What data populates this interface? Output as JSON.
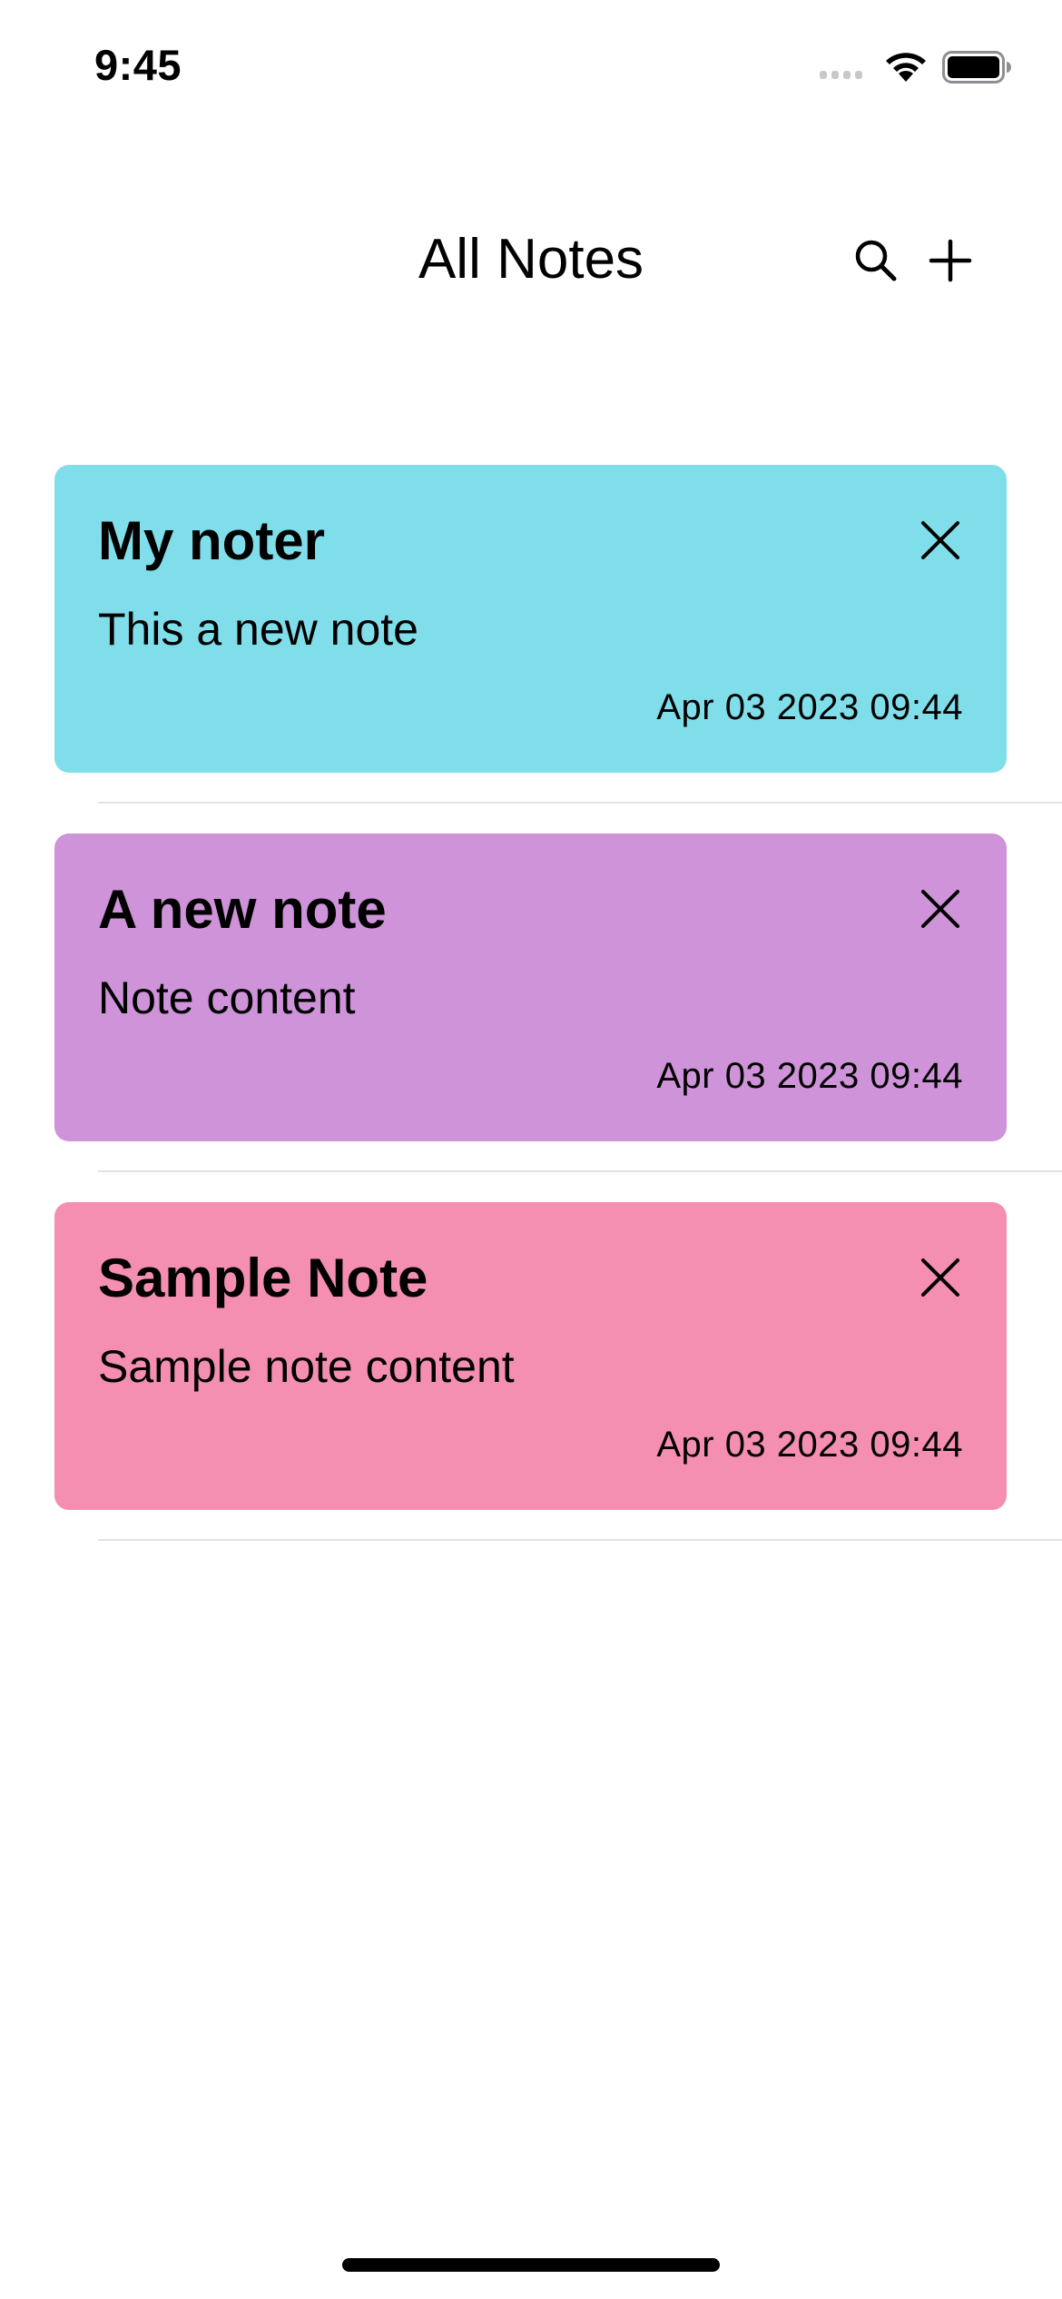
{
  "status_bar": {
    "time": "9:45"
  },
  "header": {
    "title": "All Notes",
    "search_icon": "magnifying-glass",
    "add_icon": "plus"
  },
  "notes": [
    {
      "title": "My noter",
      "content": "This a new note",
      "date": "Apr 03 2023 09:44",
      "color": "#80deea",
      "delete_icon": "xmark"
    },
    {
      "title": "A new note",
      "content": "Note content",
      "date": "Apr 03 2023 09:44",
      "color": "#ce93d8",
      "delete_icon": "xmark"
    },
    {
      "title": "Sample Note",
      "content": "Sample note content",
      "date": "Apr 03 2023 09:44",
      "color": "#f48fb1",
      "delete_icon": "xmark"
    }
  ]
}
